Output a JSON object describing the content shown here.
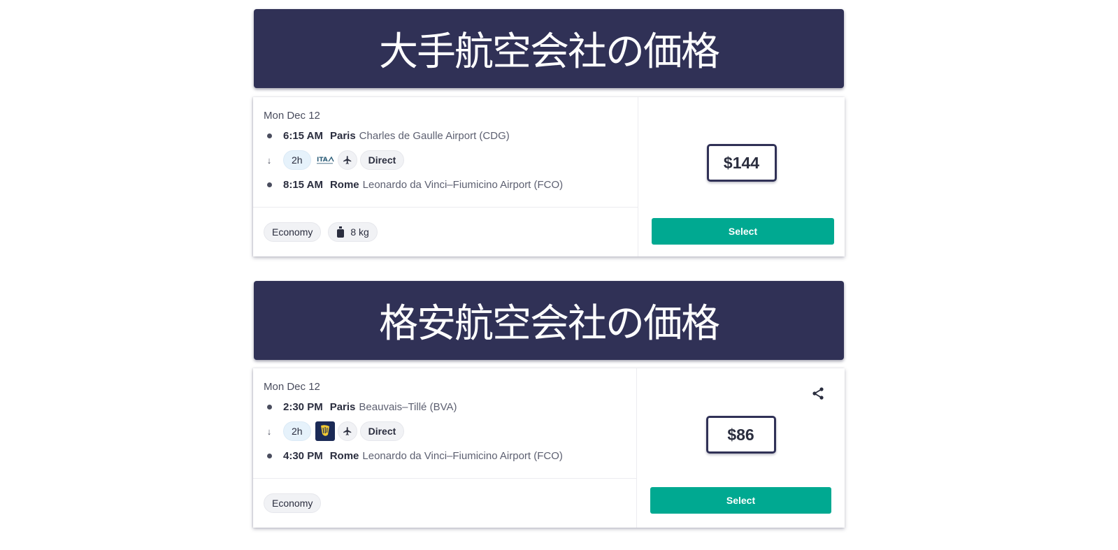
{
  "sections": [
    {
      "heading": "大手航空会社の価格",
      "flight": {
        "date": "Mon Dec 12",
        "departure": {
          "time": "6:15 AM",
          "city": "Paris",
          "airport": "Charles de Gaulle Airport (CDG)"
        },
        "duration": "2h",
        "airline_logo": "ita-airways-logo",
        "stops": "Direct",
        "arrival": {
          "time": "8:15 AM",
          "city": "Rome",
          "airport": "Leonardo da Vinci–Fiumicino Airport (FCO)"
        },
        "fare_class": "Economy",
        "baggage": "8 kg",
        "price": "$144",
        "select_label": "Select"
      }
    },
    {
      "heading": "格安航空会社の価格",
      "flight": {
        "date": "Mon Dec 12",
        "departure": {
          "time": "2:30 PM",
          "city": "Paris",
          "airport": "Beauvais–Tillé (BVA)"
        },
        "duration": "2h",
        "airline_logo": "ryanair-logo",
        "stops": "Direct",
        "arrival": {
          "time": "4:30 PM",
          "city": "Rome",
          "airport": "Leonardo da Vinci–Fiumicino Airport (FCO)"
        },
        "fare_class": "Economy",
        "price": "$86",
        "select_label": "Select",
        "share_icon": "share-icon"
      }
    }
  ],
  "colors": {
    "banner_bg": "#303156",
    "select_button": "#00a991",
    "duration_chip": "#e6f2fb",
    "price_border": "#303156"
  }
}
